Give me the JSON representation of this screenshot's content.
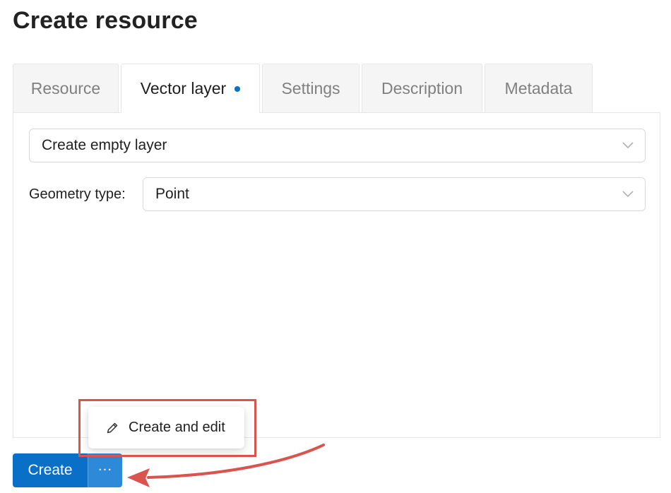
{
  "page": {
    "title": "Create resource"
  },
  "tabs": [
    {
      "label": "Resource",
      "active": false
    },
    {
      "label": "Vector layer",
      "active": true,
      "has_change_dot": true
    },
    {
      "label": "Settings",
      "active": false
    },
    {
      "label": "Description",
      "active": false
    },
    {
      "label": "Metadata",
      "active": false
    }
  ],
  "vector_layer": {
    "source_select": {
      "value": "Create empty layer"
    },
    "geometry": {
      "label": "Geometry type:",
      "value": "Point"
    }
  },
  "dropdown_menu": {
    "items": [
      {
        "label": "Create and edit",
        "icon": "pencil-icon"
      }
    ]
  },
  "actions": {
    "create_label": "Create",
    "more_label": "···"
  },
  "colors": {
    "primary": "#0a70c7",
    "primary_light": "#2d8ad8",
    "dot": "#0a70c7",
    "annotation": "#d9534f",
    "inactive_tab_text": "#808080"
  }
}
